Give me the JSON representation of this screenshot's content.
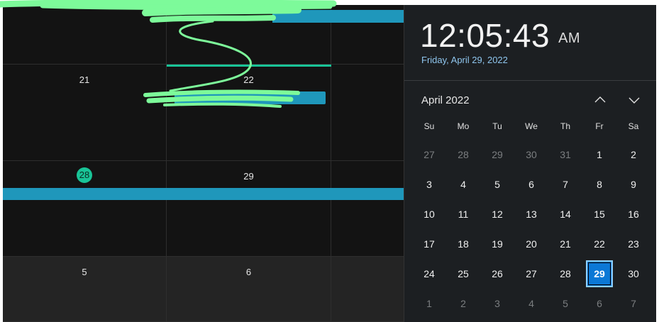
{
  "colors": {
    "grid_background": "#131313",
    "next_month_background": "#242424",
    "event_blue": "#1f97bb",
    "event_teal": "#19c497",
    "accent_date": "#8fc6ee",
    "selected_day": "#0b78d6",
    "redaction": "#7dfa9a"
  },
  "month_grid": {
    "rows": [
      {
        "days": [
          "",
          "",
          ""
        ]
      },
      {
        "days": [
          "21",
          "22",
          ""
        ]
      },
      {
        "days": [
          "28",
          "29",
          ""
        ],
        "today": "28"
      },
      {
        "days": [
          "5",
          "6",
          ""
        ]
      }
    ]
  },
  "clock": {
    "time": "12:05:43",
    "ampm": "AM",
    "full_date": "Friday, April 29, 2022"
  },
  "calendar": {
    "month_label": "April 2022",
    "prev_icon": "chevron-up-icon",
    "next_icon": "chevron-down-icon",
    "weekdays": [
      "Su",
      "Mo",
      "Tu",
      "We",
      "Th",
      "Fr",
      "Sa"
    ],
    "weeks": [
      [
        "27",
        "28",
        "29",
        "30",
        "31",
        "1",
        "2"
      ],
      [
        "3",
        "4",
        "5",
        "6",
        "7",
        "8",
        "9"
      ],
      [
        "10",
        "11",
        "12",
        "13",
        "14",
        "15",
        "16"
      ],
      [
        "17",
        "18",
        "19",
        "20",
        "21",
        "22",
        "23"
      ],
      [
        "24",
        "25",
        "26",
        "27",
        "28",
        "29",
        "30"
      ],
      [
        "1",
        "2",
        "3",
        "4",
        "5",
        "6",
        "7"
      ]
    ],
    "selected": "29"
  }
}
